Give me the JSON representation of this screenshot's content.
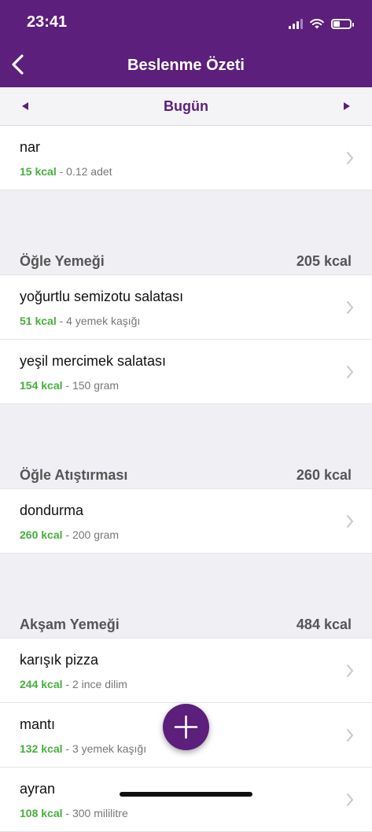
{
  "status_bar": {
    "time": "23:41",
    "battery_level": 0.35
  },
  "header": {
    "title": "Beslenme Özeti"
  },
  "date_nav": {
    "label": "Bugün"
  },
  "colors": {
    "brand": "#5c1f7b",
    "kcal_green": "#45b03c"
  },
  "top_items": [
    {
      "name": "nar",
      "kcal": "15 kcal",
      "amount": " - 0.12 adet"
    }
  ],
  "sections": [
    {
      "title": "Öğle Yemeği",
      "total": "205 kcal",
      "items": [
        {
          "name": "yoğurtlu semizotu salatası",
          "kcal": "51 kcal",
          "amount": " - 4 yemek kaşığı"
        },
        {
          "name": "yeşil mercimek salatası",
          "kcal": "154 kcal",
          "amount": " - 150 gram"
        }
      ]
    },
    {
      "title": "Öğle Atıştırması",
      "total": "260 kcal",
      "items": [
        {
          "name": "dondurma",
          "kcal": "260 kcal",
          "amount": " - 200 gram"
        }
      ]
    },
    {
      "title": "Akşam Yemeği",
      "total": "484 kcal",
      "items": [
        {
          "name": "karışık pizza",
          "kcal": "244 kcal",
          "amount": " - 2 ince dilim"
        },
        {
          "name": "mantı",
          "kcal": "132 kcal",
          "amount": " - 3 yemek kaşığı"
        },
        {
          "name": "ayran",
          "kcal": "108 kcal",
          "amount": " - 300 mililitre"
        }
      ]
    }
  ],
  "icons": {
    "back": "chevron-left-icon",
    "prev": "triangle-left-icon",
    "next": "triangle-right-icon",
    "row": "chevron-right-icon",
    "add": "plus-icon"
  }
}
